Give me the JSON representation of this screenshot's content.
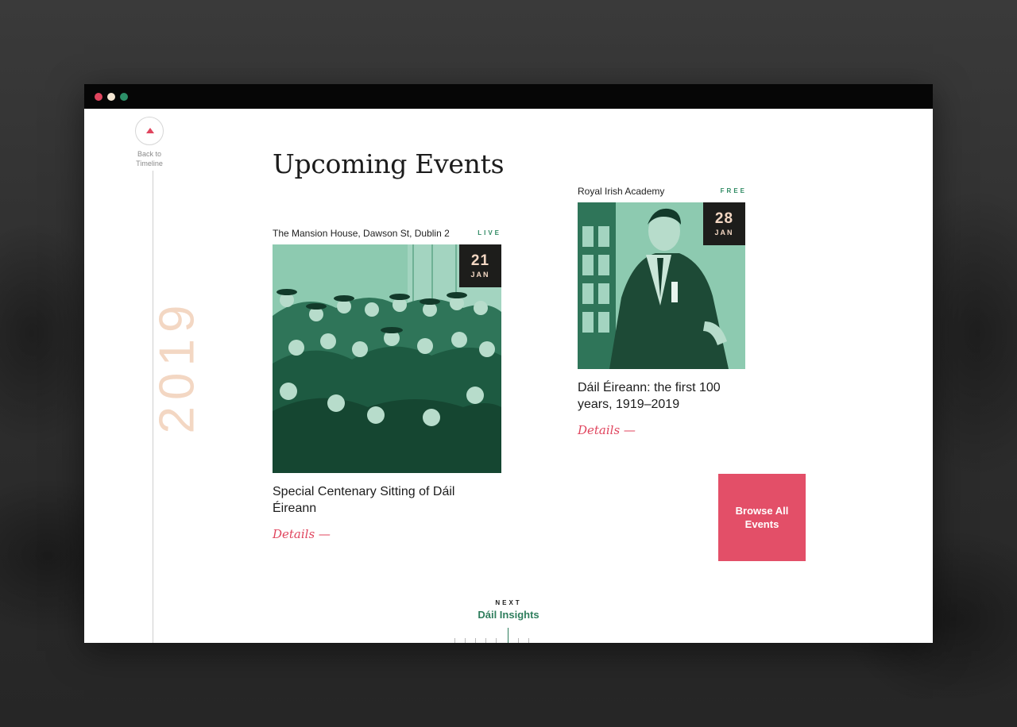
{
  "window": {
    "controls": [
      "close",
      "minimize",
      "maximize"
    ]
  },
  "sidebar": {
    "back_label": "Back to Timeline",
    "year": "2019"
  },
  "page": {
    "title": "Upcoming Events"
  },
  "events": [
    {
      "venue": "The Mansion House, Dawson St, Dublin 2",
      "tag": "LIVE",
      "day": "21",
      "month": "JAN",
      "title": "Special Centenary Sitting of Dáil Éireann",
      "details_label": "Details —"
    },
    {
      "venue": "Royal Irish Academy",
      "tag": "FREE",
      "day": "28",
      "month": "JAN",
      "title": "Dáil Éireann: the first 100 years, 1919–2019",
      "details_label": "Details —"
    }
  ],
  "browse": {
    "label": "Browse All Events"
  },
  "next": {
    "kicker": "NEXT",
    "label": "Dáil Insights"
  },
  "colors": {
    "accent": "#e34f68",
    "green": "#2f8a63",
    "peach": "#f3d7c3",
    "photo_tint": "#7fc2a7"
  }
}
